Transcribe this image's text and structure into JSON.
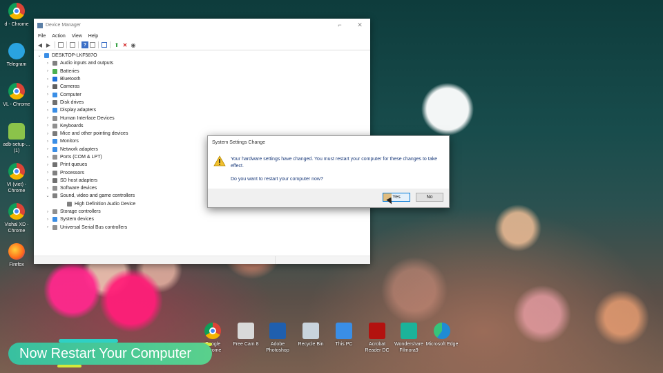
{
  "desktop_icons": [
    {
      "label": "d - Chrome",
      "icon": "chrome-icon"
    },
    {
      "label": "Telegram",
      "icon": "telegram-icon"
    },
    {
      "label": "VL - Chrome",
      "icon": "chrome-icon"
    },
    {
      "label": "adb-setup-... (1)",
      "icon": "android-icon"
    },
    {
      "label": "VI (viet) - Chrome",
      "icon": "chrome-icon"
    },
    {
      "label": "Vishal XD - Chrome",
      "icon": "chrome-icon"
    },
    {
      "label": "Firefox",
      "icon": "firefox-icon"
    }
  ],
  "device_manager": {
    "title": "Device Manager",
    "menu": [
      "File",
      "Action",
      "View",
      "Help"
    ],
    "root": "DESKTOP-LKF587O",
    "nodes": [
      {
        "label": "Audio inputs and outputs",
        "expanded": false,
        "color": "#808080"
      },
      {
        "label": "Batteries",
        "expanded": false,
        "color": "#4caf50"
      },
      {
        "label": "Bluetooth",
        "expanded": false,
        "color": "#1e6fd9"
      },
      {
        "label": "Cameras",
        "expanded": false,
        "color": "#606060"
      },
      {
        "label": "Computer",
        "expanded": false,
        "color": "#3a8ee6"
      },
      {
        "label": "Disk drives",
        "expanded": false,
        "color": "#707070"
      },
      {
        "label": "Display adapters",
        "expanded": false,
        "color": "#3a8ee6"
      },
      {
        "label": "Human Interface Devices",
        "expanded": false,
        "color": "#8d8d8d"
      },
      {
        "label": "Keyboards",
        "expanded": false,
        "color": "#909090"
      },
      {
        "label": "Mice and other pointing devices",
        "expanded": false,
        "color": "#7a7a7a"
      },
      {
        "label": "Monitors",
        "expanded": false,
        "color": "#3a8ee6"
      },
      {
        "label": "Network adapters",
        "expanded": false,
        "color": "#3a8ee6"
      },
      {
        "label": "Ports (COM & LPT)",
        "expanded": false,
        "color": "#909090"
      },
      {
        "label": "Print queues",
        "expanded": false,
        "color": "#707070"
      },
      {
        "label": "Processors",
        "expanded": false,
        "color": "#808080"
      },
      {
        "label": "SD host adapters",
        "expanded": false,
        "color": "#707070"
      },
      {
        "label": "Software devices",
        "expanded": false,
        "color": "#909090"
      },
      {
        "label": "Sound, video and game controllers",
        "expanded": true,
        "color": "#808080"
      },
      {
        "label": "High Definition Audio Device",
        "child": true,
        "color": "#808080"
      },
      {
        "label": "Storage controllers",
        "expanded": false,
        "color": "#909090"
      },
      {
        "label": "System devices",
        "expanded": false,
        "color": "#3a8ee6"
      },
      {
        "label": "Universal Serial Bus controllers",
        "expanded": false,
        "color": "#909090"
      }
    ]
  },
  "dialog": {
    "title": "System Settings Change",
    "message": "Your hardware settings have changed. You must restart your computer for these changes to take effect.",
    "question": "Do you want to restart your computer now?",
    "yes_label": "Yes",
    "no_label": "No"
  },
  "app_icons": [
    {
      "label": "Google Chrome",
      "icon": "chrome-icon"
    },
    {
      "label": "Free Cam 8",
      "icon": "freecam-icon",
      "color": "#d9d9d9"
    },
    {
      "label": "Adobe Photoshop",
      "icon": "photoshop-icon",
      "color": "#1f5fae"
    },
    {
      "label": "Recycle Bin",
      "icon": "recycle-bin-icon",
      "color": "#c9d4dd"
    },
    {
      "label": "This PC",
      "icon": "this-pc-icon",
      "color": "#3a8ee6"
    },
    {
      "label": "Acrobat Reader DC",
      "icon": "acrobat-icon",
      "color": "#b3120f"
    },
    {
      "label": "Wondershare Filmora9",
      "icon": "filmora-icon",
      "color": "#1bb39a"
    },
    {
      "label": "Microsoft Edge",
      "icon": "edge-icon",
      "color": "#1f8bd4"
    }
  ],
  "caption": {
    "text": "Now Restart Your Computer"
  },
  "colors": {
    "accent": "#0078d7",
    "caption": "#4ac896",
    "dialog_text": "#1a3a7a"
  }
}
